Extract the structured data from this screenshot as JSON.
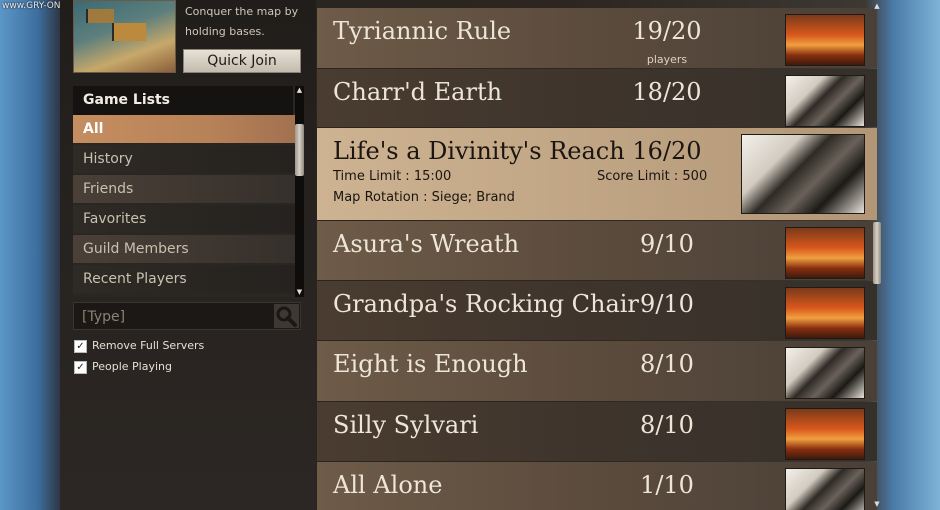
{
  "watermark": "www.GRY-ONLINE.PL",
  "mode": {
    "description": "Conquer the map by\nholding bases.",
    "quick_join_label": "Quick Join"
  },
  "game_lists": {
    "header": "Game Lists",
    "items": [
      "All",
      "History",
      "Friends",
      "Favorites",
      "Guild Members",
      "Recent Players"
    ],
    "selected": "All"
  },
  "search": {
    "placeholder": "[Type]"
  },
  "filters": [
    {
      "label": "Remove Full Servers",
      "checked": true
    },
    {
      "label": "People Playing",
      "checked": true
    }
  ],
  "servers": {
    "players_caption": "players",
    "rows": [
      {
        "name": "Tyriannic Rule",
        "count": "19/20",
        "map": "fire"
      },
      {
        "name": "Charr'd Earth",
        "count": "18/20",
        "map": "dragon"
      },
      {
        "name": "Life's a Divinity's Reach",
        "count": "16/20",
        "map": "dragon",
        "time_limit": "Time Limit :  15:00",
        "score_limit": "Score Limit :  500",
        "map_rotation": "Map Rotation :  Siege; Brand"
      },
      {
        "name": "Asura's Wreath",
        "count": "9/10",
        "map": "fire"
      },
      {
        "name": "Grandpa's Rocking Chair",
        "count": "9/10",
        "map": "fire"
      },
      {
        "name": "Eight is Enough",
        "count": "8/10",
        "map": "dragon"
      },
      {
        "name": "Silly Sylvari",
        "count": "8/10",
        "map": "fire"
      },
      {
        "name": "All Alone",
        "count": "1/10",
        "map": "dragon"
      }
    ]
  },
  "icons": {
    "search": "magnifier-icon",
    "check": "checkmark-icon",
    "scroll_up": "arrow-up-icon",
    "scroll_down": "arrow-down-icon"
  },
  "colors": {
    "selected_list_item": "#c48e60",
    "selected_row": "#ceb392"
  }
}
